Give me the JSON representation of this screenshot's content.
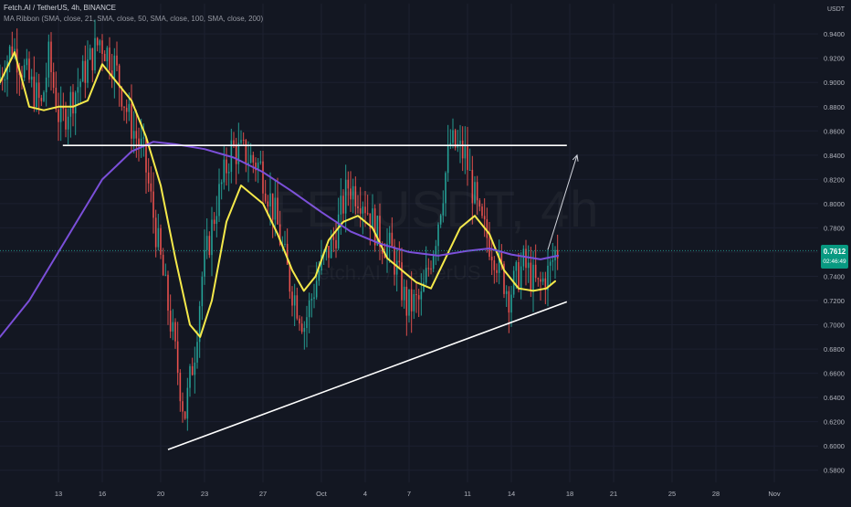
{
  "header": {
    "title": "Fetch.AI / TetherUS, 4h, BINANCE",
    "ribbon": "MA Ribbon (SMA, close, 21, SMA, close, 50, SMA, close, 100, SMA, close, 200)"
  },
  "watermark": {
    "symbol": "FETUSDT, 4h",
    "name": "Fetch.AI / TetherUS"
  },
  "price_badge": {
    "price": "0.7612",
    "countdown": "02:46:49"
  },
  "colors": {
    "background": "#131722",
    "grid": "#1c2030",
    "up": "#26a69a",
    "down": "#ef5350",
    "sma21": "#f5e94a",
    "sma200": "#7b4fd9",
    "trendline": "#ffffff",
    "axis_text": "#b2b5be"
  },
  "chart_data": {
    "type": "candlestick",
    "title": "Fetch.AI / TetherUS, 4h, BINANCE",
    "y_axis": {
      "unit": "USDT",
      "range": [
        0.57,
        0.965
      ],
      "ticks": [
        "0.9400",
        "0.9200",
        "0.9000",
        "0.8800",
        "0.8600",
        "0.8400",
        "0.8200",
        "0.8000",
        "0.7800",
        "0.7600",
        "0.7400",
        "0.7200",
        "0.7000",
        "0.6800",
        "0.6600",
        "0.6400",
        "0.6200",
        "0.6000",
        "0.5800"
      ]
    },
    "x_axis": {
      "ticks": [
        {
          "label": "13",
          "day": 13
        },
        {
          "label": "16",
          "day": 16
        },
        {
          "label": "20",
          "day": 20
        },
        {
          "label": "23",
          "day": 23
        },
        {
          "label": "27",
          "day": 27
        },
        {
          "label": "Oct",
          "day": 31
        },
        {
          "label": "4",
          "day": 34
        },
        {
          "label": "7",
          "day": 37
        },
        {
          "label": "11",
          "day": 41
        },
        {
          "label": "14",
          "day": 44
        },
        {
          "label": "18",
          "day": 48
        },
        {
          "label": "21",
          "day": 51
        },
        {
          "label": "25",
          "day": 55
        },
        {
          "label": "28",
          "day": 58
        },
        {
          "label": "Nov",
          "day": 62
        }
      ],
      "range": [
        9.0,
        65.0
      ],
      "note": "day index counts September days; Oct = day 31"
    },
    "price_path": [
      [
        9.0,
        0.9
      ],
      [
        10.0,
        0.93
      ],
      [
        11.0,
        0.905
      ],
      [
        12.0,
        0.88
      ],
      [
        12.5,
        0.92
      ],
      [
        13.3,
        0.865
      ],
      [
        14.0,
        0.885
      ],
      [
        15.0,
        0.91
      ],
      [
        16.0,
        0.935
      ],
      [
        17.0,
        0.915
      ],
      [
        18.0,
        0.87
      ],
      [
        19.0,
        0.84
      ],
      [
        20.0,
        0.765
      ],
      [
        21.0,
        0.69
      ],
      [
        21.8,
        0.625
      ],
      [
        22.5,
        0.68
      ],
      [
        23.0,
        0.74
      ],
      [
        24.0,
        0.8
      ],
      [
        25.0,
        0.845
      ],
      [
        26.0,
        0.84
      ],
      [
        27.0,
        0.83
      ],
      [
        28.0,
        0.79
      ],
      [
        29.0,
        0.735
      ],
      [
        30.0,
        0.7
      ],
      [
        31.0,
        0.745
      ],
      [
        32.0,
        0.77
      ],
      [
        33.0,
        0.815
      ],
      [
        34.0,
        0.805
      ],
      [
        35.0,
        0.775
      ],
      [
        36.0,
        0.76
      ],
      [
        37.0,
        0.715
      ],
      [
        38.0,
        0.72
      ],
      [
        39.0,
        0.775
      ],
      [
        40.0,
        0.85
      ],
      [
        41.0,
        0.84
      ],
      [
        42.0,
        0.785
      ],
      [
        43.0,
        0.76
      ],
      [
        44.0,
        0.725
      ],
      [
        45.0,
        0.75
      ],
      [
        46.0,
        0.73
      ],
      [
        46.8,
        0.745
      ],
      [
        47.2,
        0.761
      ]
    ],
    "series": [
      {
        "name": "SMA 21",
        "color": "#f5e94a",
        "points": [
          [
            9.0,
            0.9
          ],
          [
            10.0,
            0.925
          ],
          [
            11.0,
            0.88
          ],
          [
            12.0,
            0.877
          ],
          [
            13.0,
            0.88
          ],
          [
            14.0,
            0.88
          ],
          [
            15.0,
            0.885
          ],
          [
            16.0,
            0.915
          ],
          [
            17.0,
            0.9
          ],
          [
            18.0,
            0.885
          ],
          [
            19.0,
            0.855
          ],
          [
            20.0,
            0.815
          ],
          [
            21.0,
            0.755
          ],
          [
            22.0,
            0.7
          ],
          [
            22.7,
            0.69
          ],
          [
            23.5,
            0.72
          ],
          [
            24.5,
            0.785
          ],
          [
            25.5,
            0.815
          ],
          [
            26.3,
            0.807
          ],
          [
            27.0,
            0.8
          ],
          [
            28.0,
            0.775
          ],
          [
            29.0,
            0.745
          ],
          [
            29.8,
            0.728
          ],
          [
            30.6,
            0.74
          ],
          [
            31.5,
            0.77
          ],
          [
            32.5,
            0.785
          ],
          [
            33.5,
            0.79
          ],
          [
            34.5,
            0.78
          ],
          [
            35.5,
            0.755
          ],
          [
            36.5,
            0.745
          ],
          [
            37.5,
            0.735
          ],
          [
            38.5,
            0.73
          ],
          [
            39.5,
            0.755
          ],
          [
            40.5,
            0.78
          ],
          [
            41.5,
            0.79
          ],
          [
            42.5,
            0.775
          ],
          [
            43.5,
            0.745
          ],
          [
            44.5,
            0.73
          ],
          [
            45.5,
            0.728
          ],
          [
            46.4,
            0.73
          ],
          [
            47.0,
            0.736
          ]
        ]
      },
      {
        "name": "SMA 200",
        "color": "#7b4fd9",
        "points": [
          [
            9.0,
            0.69
          ],
          [
            11.0,
            0.72
          ],
          [
            13.0,
            0.76
          ],
          [
            15.0,
            0.8
          ],
          [
            16.0,
            0.82
          ],
          [
            18.0,
            0.843
          ],
          [
            19.5,
            0.851
          ],
          [
            21.0,
            0.849
          ],
          [
            23.0,
            0.845
          ],
          [
            25.0,
            0.838
          ],
          [
            27.0,
            0.826
          ],
          [
            29.0,
            0.81
          ],
          [
            31.0,
            0.793
          ],
          [
            33.0,
            0.777
          ],
          [
            35.0,
            0.767
          ],
          [
            37.0,
            0.76
          ],
          [
            39.0,
            0.757
          ],
          [
            41.0,
            0.761
          ],
          [
            42.5,
            0.763
          ],
          [
            44.0,
            0.758
          ],
          [
            46.0,
            0.754
          ],
          [
            47.2,
            0.757
          ]
        ]
      }
    ],
    "annotations": {
      "resistance": {
        "y": 0.848,
        "x": [
          13.3,
          47.8
        ]
      },
      "support": {
        "from": [
          20.5,
          0.597
        ],
        "to": [
          47.8,
          0.719
        ]
      },
      "arrow": {
        "from": [
          46.5,
          0.762
        ],
        "to": [
          48.5,
          0.84
        ]
      }
    },
    "current_price_line": 0.7612,
    "grid": true,
    "legend": "top-left"
  }
}
